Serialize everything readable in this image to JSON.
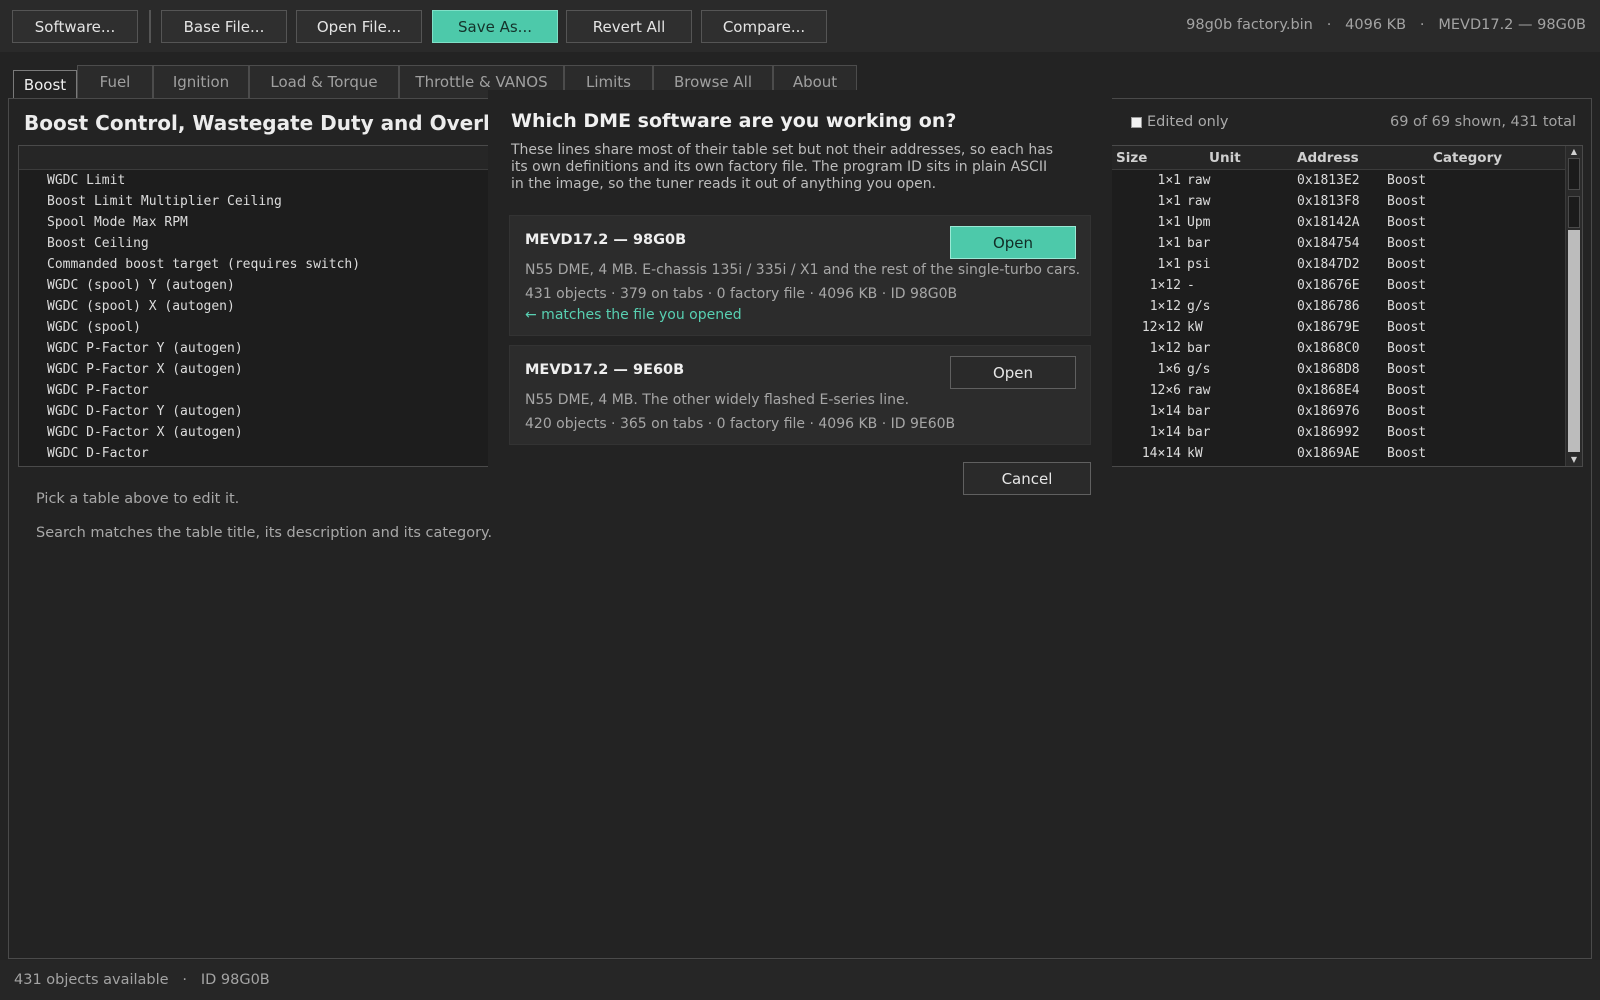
{
  "toolbar": {
    "buttons": [
      "Software...",
      "Base File...",
      "Open File...",
      "Save As...",
      "Revert All",
      "Compare..."
    ],
    "file_info": "98g0b factory.bin   ·   4096 KB   ·   MEVD17.2 — 98G0B"
  },
  "tabs": [
    "Boost",
    "Fuel",
    "Ignition",
    "Load & Torque",
    "Throttle & VANOS",
    "Limits",
    "Browse All",
    "About"
  ],
  "main": {
    "title": "Boost Control, Wastegate Duty and Overboost",
    "edited_only": "Edited only",
    "count": "69 of 69 shown, 431 total",
    "columns": [
      "Size",
      "Unit",
      "Address",
      "Category"
    ],
    "rows": [
      {
        "name": "WGDC Limit",
        "size": "1×1",
        "unit": "raw",
        "address": "0x1813E2",
        "category": "Boost"
      },
      {
        "name": "Boost Limit Multiplier Ceiling",
        "size": "1×1",
        "unit": "raw",
        "address": "0x1813F8",
        "category": "Boost"
      },
      {
        "name": "Spool Mode Max RPM",
        "size": "1×1",
        "unit": "Upm",
        "address": "0x18142A",
        "category": "Boost"
      },
      {
        "name": "Boost Ceiling",
        "size": "1×1",
        "unit": "bar",
        "address": "0x184754",
        "category": "Boost"
      },
      {
        "name": "Commanded boost target (requires switch)",
        "size": "1×1",
        "unit": "psi",
        "address": "0x1847D2",
        "category": "Boost"
      },
      {
        "name": "WGDC (spool) Y (autogen)",
        "size": "1×12",
        "unit": "-",
        "address": "0x18676E",
        "category": "Boost"
      },
      {
        "name": "WGDC (spool) X (autogen)",
        "size": "1×12",
        "unit": "g/s",
        "address": "0x186786",
        "category": "Boost"
      },
      {
        "name": "WGDC (spool)",
        "size": "12×12",
        "unit": "kW",
        "address": "0x18679E",
        "category": "Boost"
      },
      {
        "name": "WGDC P-Factor Y (autogen)",
        "size": "1×12",
        "unit": "bar",
        "address": "0x1868C0",
        "category": "Boost"
      },
      {
        "name": "WGDC P-Factor X (autogen)",
        "size": "1×6",
        "unit": "g/s",
        "address": "0x1868D8",
        "category": "Boost"
      },
      {
        "name": "WGDC P-Factor",
        "size": "12×6",
        "unit": "raw",
        "address": "0x1868E4",
        "category": "Boost"
      },
      {
        "name": "WGDC D-Factor Y (autogen)",
        "size": "1×14",
        "unit": "bar",
        "address": "0x186976",
        "category": "Boost"
      },
      {
        "name": "WGDC D-Factor X (autogen)",
        "size": "1×14",
        "unit": "bar",
        "address": "0x186992",
        "category": "Boost"
      },
      {
        "name": "WGDC D-Factor",
        "size": "14×14",
        "unit": "kW",
        "address": "0x1869AE",
        "category": "Boost"
      }
    ],
    "hint1": "Pick a table above to edit it.",
    "hint2": "Search matches the table title, its description and its category."
  },
  "modal": {
    "title": "Which DME software are you working on?",
    "description": "These lines share most of their table set but not their addresses, so each has its own definitions and its own factory file. The program ID sits in plain ASCII in the image, so the tuner reads it out of anything you open.",
    "cards": [
      {
        "name": "MEVD17.2 — 98G0B",
        "desc": "N55 DME, 4 MB. E-chassis 135i / 335i / X1 and the rest of the single-turbo cars.",
        "stats": "431 objects · 379 on tabs · 0 factory file · 4096 KB · ID 98G0B",
        "match": "← matches the file you opened",
        "button": "Open"
      },
      {
        "name": "MEVD17.2 — 9E60B",
        "desc": "N55 DME, 4 MB. The other widely flashed E-series line.",
        "stats": "420 objects · 365 on tabs · 0 factory file · 4096 KB · ID 9E60B",
        "button": "Open"
      }
    ],
    "cancel": "Cancel"
  },
  "status": "431 objects available   ·   ID 98G0B",
  "colors": {
    "accent": "#4dc9aa",
    "background": "#232323",
    "match_text": "#58d0b2"
  }
}
